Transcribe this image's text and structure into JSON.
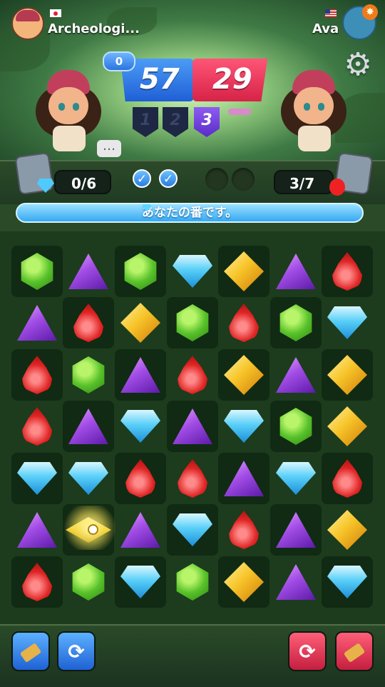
{
  "player_left": {
    "name": "Archeologi...",
    "flag": "japan-flag-icon"
  },
  "player_right": {
    "name": "Ava",
    "flag": "usa-flag-icon"
  },
  "score": {
    "turn_badge": "0",
    "blue": "57",
    "red": "29"
  },
  "rounds": [
    "1",
    "2",
    "3"
  ],
  "goals": {
    "left": "0/6",
    "right": "3/7"
  },
  "message": "あなたの番です。",
  "board": {
    "rows": [
      [
        "green",
        "purple",
        "green",
        "blue",
        "yellow",
        "purple",
        "red"
      ],
      [
        "purple",
        "red",
        "yellow",
        "green",
        "red",
        "green",
        "blue"
      ],
      [
        "red",
        "green",
        "purple",
        "red",
        "yellow",
        "purple",
        "yellow"
      ],
      [
        "red",
        "purple",
        "blue",
        "purple",
        "blue",
        "green",
        "yellow"
      ],
      [
        "blue",
        "blue",
        "red",
        "red",
        "purple",
        "blue",
        "red"
      ],
      [
        "purple",
        "special",
        "purple",
        "blue",
        "red",
        "purple",
        "yellow"
      ],
      [
        "red",
        "green",
        "blue",
        "green",
        "yellow",
        "purple",
        "blue"
      ]
    ]
  },
  "colors": {
    "blue_team": "#1f5fd6",
    "red_team": "#d62347",
    "board_bg": "#1c3c1d"
  },
  "icons": {
    "settings": "gear-icon",
    "chat": "chat-bubble-icon",
    "checks": [
      "check-icon",
      "check-icon"
    ]
  }
}
